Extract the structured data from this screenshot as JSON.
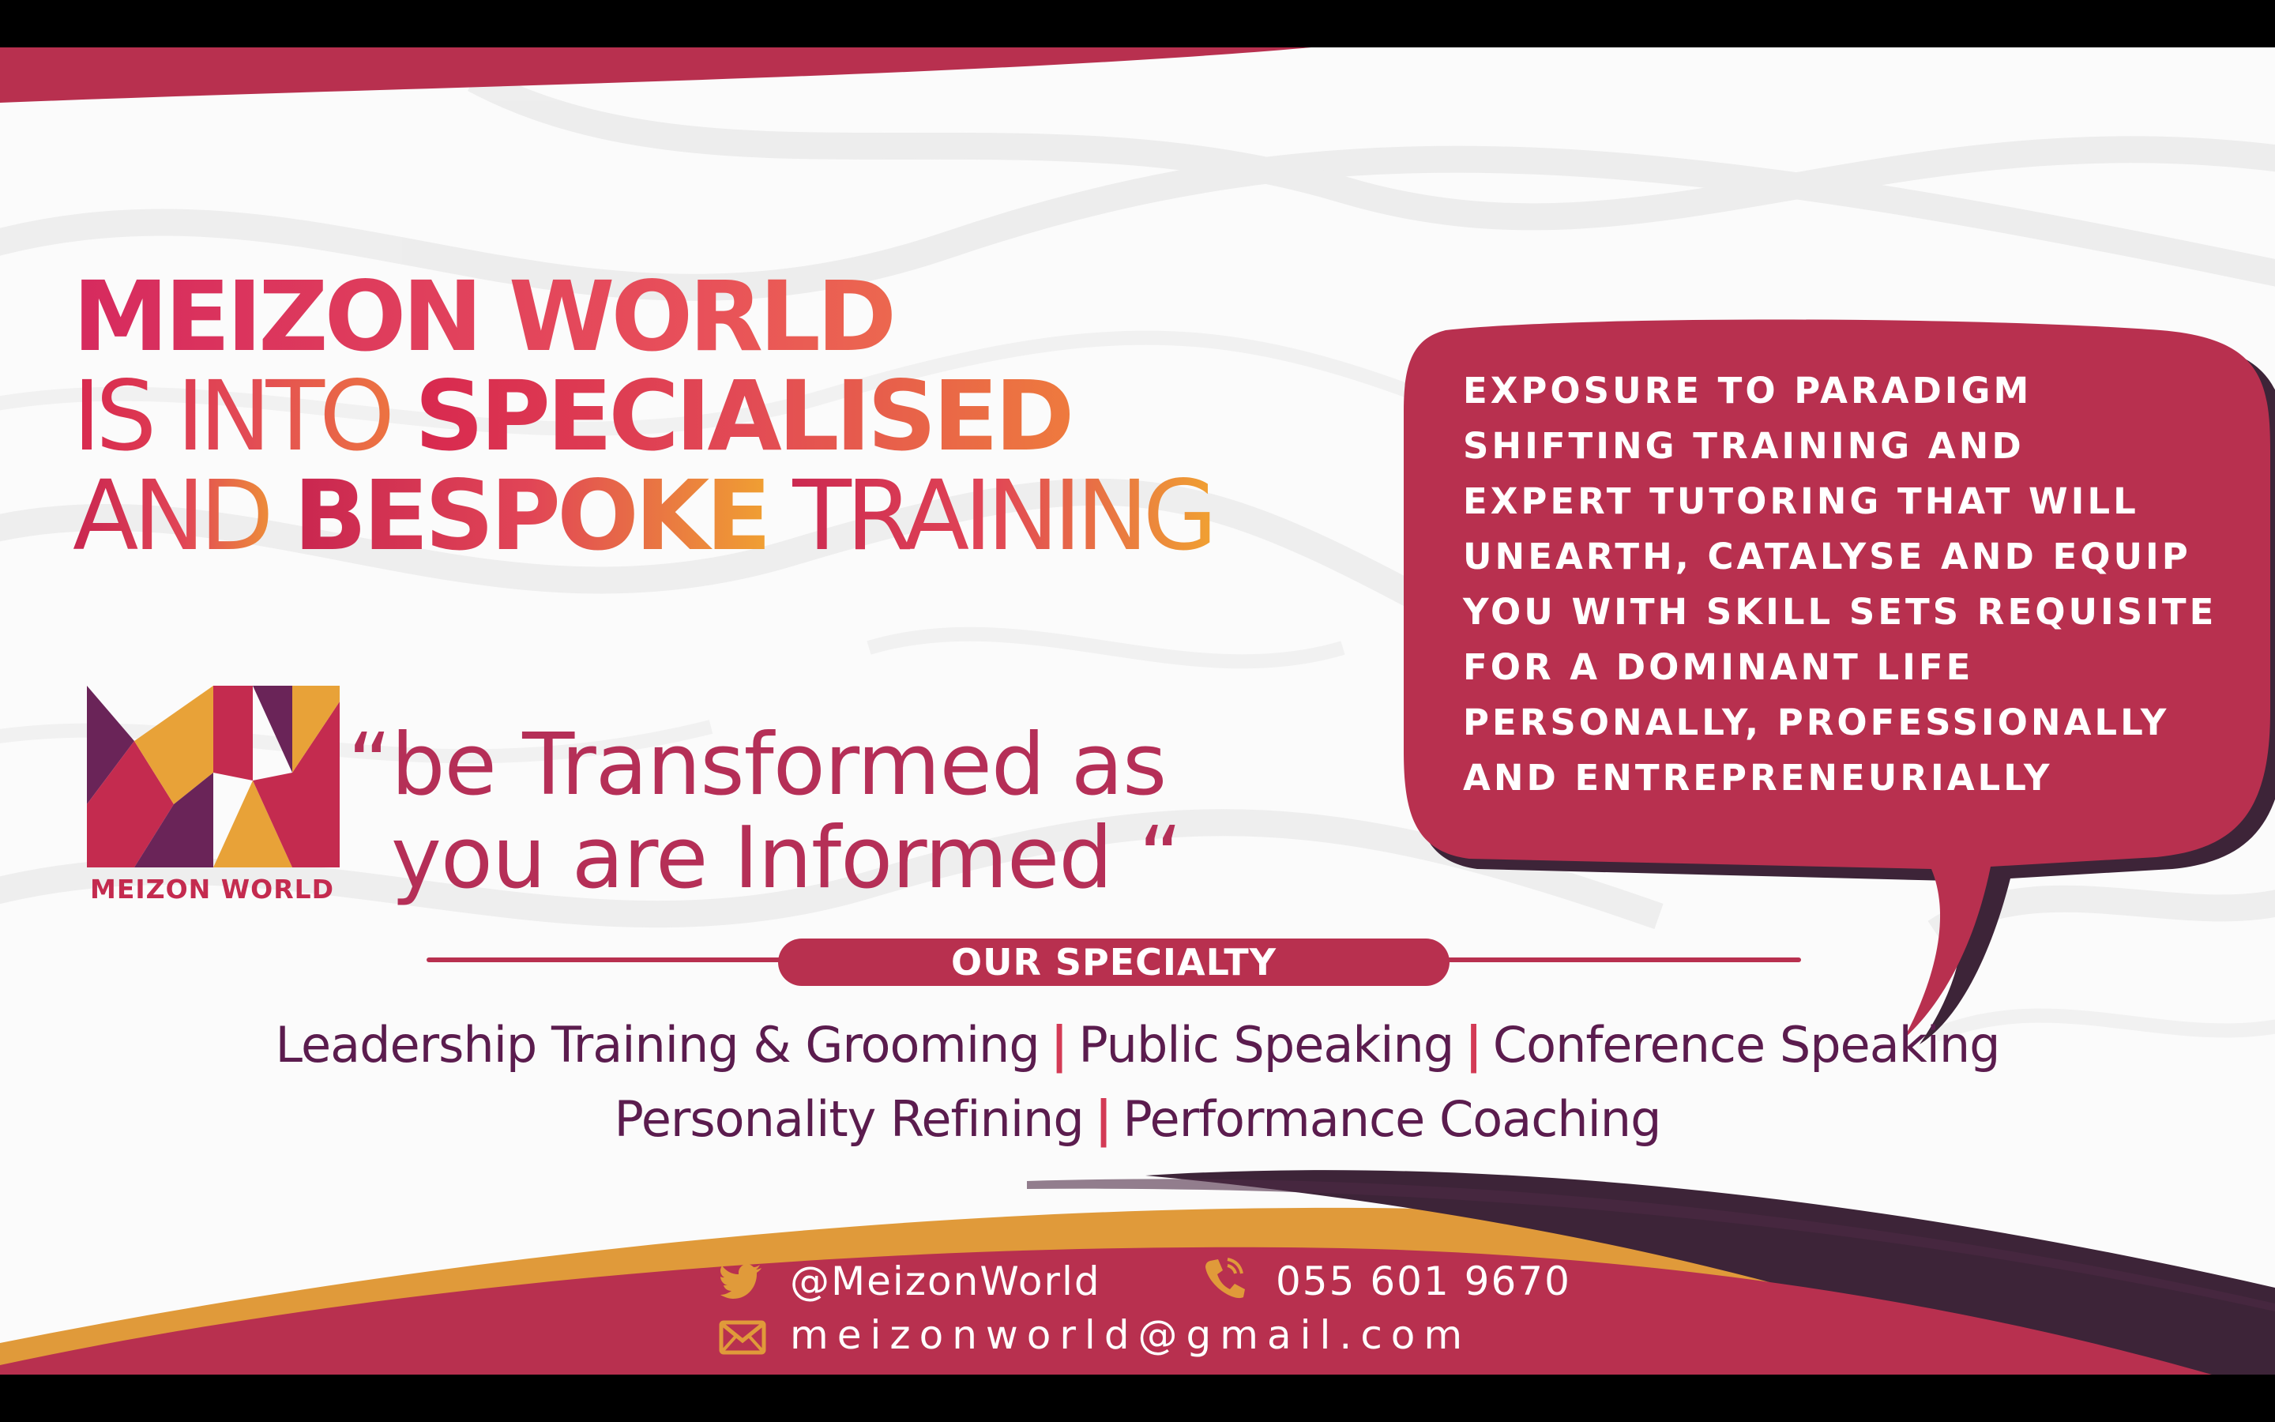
{
  "headline": {
    "line1": "MEIZON WORLD",
    "line2_prefix": "IS INTO ",
    "line2_bold": "SPECIALISED",
    "line3_prefix": "AND ",
    "line3_bold": "BESPOKE",
    "line3_suffix": " TRAINING"
  },
  "logo": {
    "name": "MEIZON WORLD",
    "colors": [
      "#6a2458",
      "#c42b4f",
      "#e8a238"
    ]
  },
  "tagline": {
    "line1": "“be Transformed as",
    "line2": "you are Informed “"
  },
  "bubble": {
    "lines": [
      "EXPOSURE TO PARADIGM",
      "SHIFTING TRAINING AND",
      "EXPERT TUTORING THAT WILL",
      "UNEARTH, CATALYSE AND EQUIP",
      "YOU WITH SKILL SETS REQUISITE",
      "FOR A DOMINANT LIFE",
      "PERSONALLY, PROFESSIONALLY",
      "AND ENTREPRENEURIALLY"
    ]
  },
  "specialty": {
    "heading": "OUR SPECIALTY",
    "row1": [
      "Leadership Training & Grooming",
      "Public Speaking",
      "Conference Speaking"
    ],
    "row2": [
      "Personality Refining",
      "Performance Coaching"
    ],
    "separator": "|"
  },
  "contact": {
    "twitter": "@MeizonWorld",
    "phone": "055 601 9670",
    "email": "meizonworld@gmail.com",
    "icons": [
      "twitter-icon",
      "phone-icon",
      "mail-icon"
    ]
  },
  "colors": {
    "crimson": "#b8304f",
    "gold": "#e09a3a",
    "plum": "#3d2438",
    "purple_text": "#5b1c4e"
  }
}
